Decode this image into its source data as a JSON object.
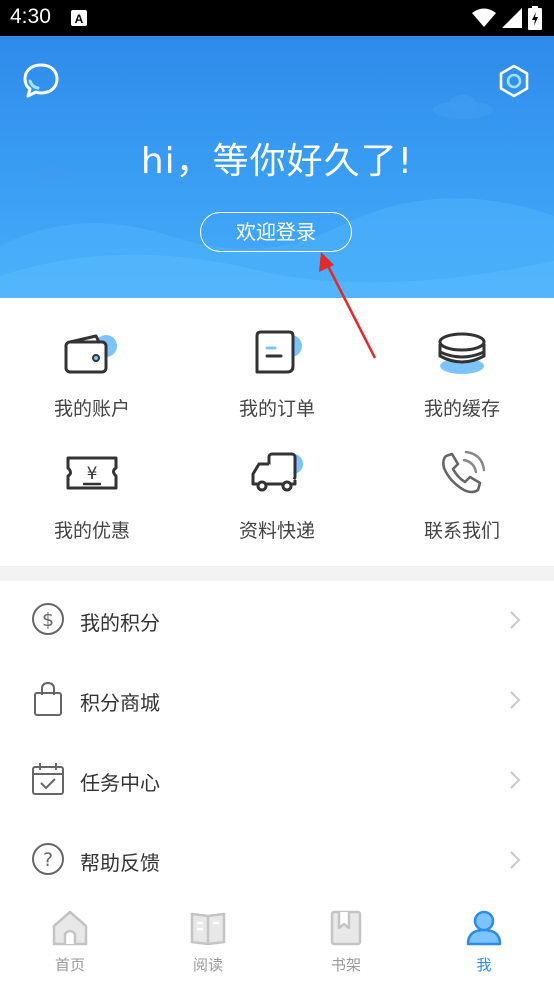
{
  "status_bar": {
    "time": "4:30",
    "a_label": "A"
  },
  "header": {
    "greeting": "hi，等你好久了!",
    "login_label": "欢迎登录"
  },
  "grid": {
    "items": [
      {
        "label": "我的账户",
        "icon": "wallet-icon"
      },
      {
        "label": "我的订单",
        "icon": "order-icon"
      },
      {
        "label": "我的缓存",
        "icon": "cache-icon"
      },
      {
        "label": "我的优惠",
        "icon": "coupon-icon"
      },
      {
        "label": "资料快递",
        "icon": "truck-icon"
      },
      {
        "label": "联系我们",
        "icon": "phone-icon"
      }
    ]
  },
  "list": {
    "items": [
      {
        "label": "我的积分",
        "icon": "points-icon"
      },
      {
        "label": "积分商城",
        "icon": "shopping-bag-icon"
      },
      {
        "label": "任务中心",
        "icon": "task-calendar-icon"
      },
      {
        "label": "帮助反馈",
        "icon": "help-icon"
      }
    ]
  },
  "tabs": {
    "items": [
      {
        "label": "首页",
        "icon": "home-icon"
      },
      {
        "label": "阅读",
        "icon": "read-icon"
      },
      {
        "label": "书架",
        "icon": "bookshelf-icon"
      },
      {
        "label": "我",
        "icon": "profile-icon"
      }
    ],
    "active": "我"
  },
  "colors": {
    "primary": "#2f8bea",
    "accent_light": "#7cc4ff",
    "annotation_arrow": "#e32a2a"
  }
}
